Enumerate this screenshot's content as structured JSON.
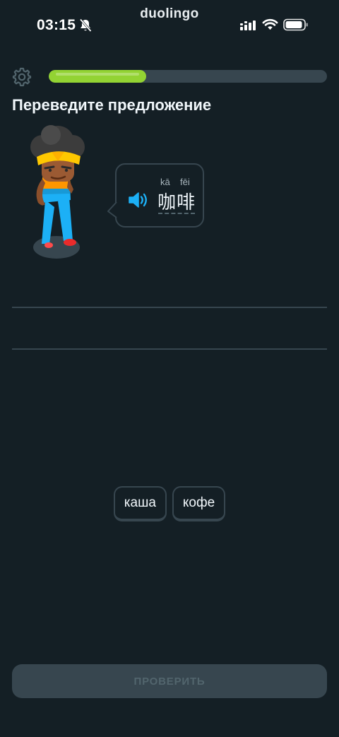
{
  "status_bar": {
    "time": "03:15",
    "app_name": "duolingo",
    "silent_mode": true
  },
  "lesson": {
    "progress_fraction": 0.35,
    "prompt": "Переведите предложение"
  },
  "phrase": {
    "pinyin": [
      "kā",
      "fēi"
    ],
    "hanzi": "咖啡"
  },
  "word_bank": [
    "каша",
    "кофе"
  ],
  "check_button": {
    "label": "ПРОВЕРИТЬ",
    "enabled": false
  },
  "colors": {
    "background": "#141f25",
    "progress_fill": "#93d333",
    "progress_track": "#37464f",
    "speaker": "#1cb0f6",
    "tile_border": "#37464f",
    "disabled_button": "#37464f",
    "disabled_text": "#52656d"
  },
  "icons": {
    "settings": "gear-icon",
    "audio": "speaker-icon",
    "silent": "bell-slash-icon"
  }
}
